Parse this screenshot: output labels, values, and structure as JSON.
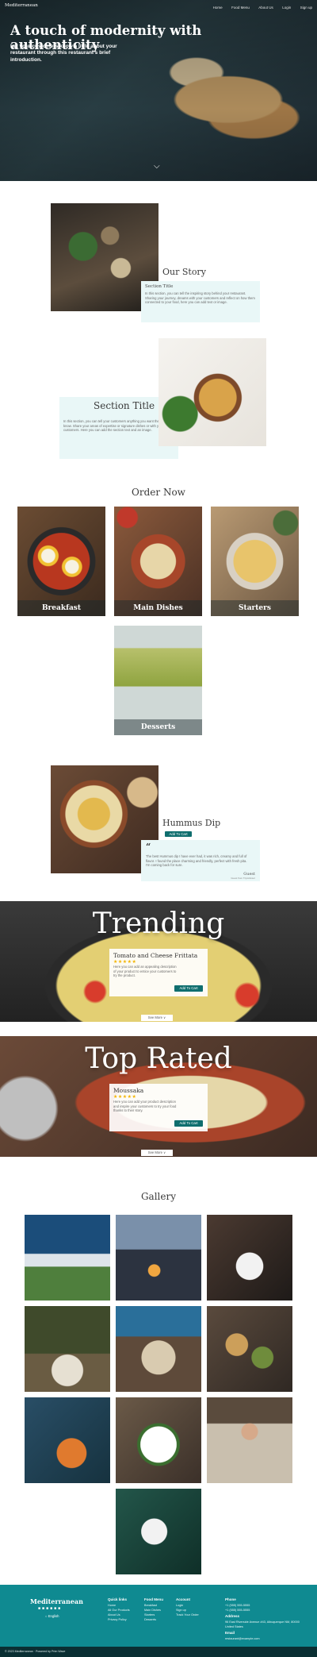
{
  "header": {
    "brand": "Mediterranean",
    "nav": [
      "Home",
      "Food Menu",
      "About Us",
      "Login",
      "Sign up"
    ]
  },
  "hero": {
    "title": "A touch of modernity with authenticity",
    "subtitle": "Let your customers know a little about your restaurant through this restaurant's brief introduction."
  },
  "story": {
    "title": "Our Story",
    "card_title": "Section Title",
    "card_text": "In this section, you can tell the inspiring story behind your restaurant. Sharing your journey, dreams with your customers and reflect on how them connected to your food, here you can add text or image."
  },
  "section2": {
    "title": "Section Title",
    "text": "In this section, you can tell your customers anything you want them to know. Share your areas of expertise or signature dishes or with your customers. Here you can add the section text and an image."
  },
  "order": {
    "title": "Order Now",
    "categories": [
      "Breakfast",
      "Main Dishes",
      "Starters",
      "Desserts"
    ]
  },
  "featured": {
    "title": "Hummus Dip",
    "button": "Add To Cart",
    "quote_mark": "“",
    "quote": "The best Hummus dip I have ever had, it was rich, creamy and full of flavor. I found the place charming and friendly, perfect with fresh pita. I'm coming back for sure.",
    "author": "Guest",
    "author_sub": "Guest from TripAdvisor"
  },
  "trending": {
    "title": "Trending",
    "item": "Tomato and Cheese Frittata",
    "stars": "★★★★★",
    "text": "Here you can add an appealing description of your product to entice your customers to try the product.",
    "button": "Add To Cart",
    "see_more": "See More"
  },
  "toprated": {
    "title": "Top Rated",
    "item": "Moussaka",
    "stars": "★★★★★",
    "text": "Here you can add your product description and inspire your customers to try your food thanks to their story.",
    "button": "Add To Cart",
    "see_more": "See More"
  },
  "gallery": {
    "title": "Gallery"
  },
  "footer": {
    "brand": "Mediterranean",
    "language": "English",
    "quick_links": {
      "title": "Quick links",
      "items": [
        "Home",
        "All Our Products",
        "About Us",
        "Privacy Policy"
      ]
    },
    "food_menu": {
      "title": "Food Menu",
      "items": [
        "Breakfast",
        "Main Dishes",
        "Starters",
        "Desserts"
      ]
    },
    "account": {
      "title": "Account",
      "items": [
        "Login",
        "Sign up",
        "Track Your Order"
      ]
    },
    "phone": {
      "title": "Phone",
      "items": [
        "+1 (555) 555-5555",
        "+1 (555) 555-5555"
      ]
    },
    "address": {
      "title": "Address",
      "value": "96 East Riverside Avenue #43, Albuquerque NM, 80000 United States"
    },
    "email": {
      "title": "Email",
      "value": "restaurant@example.com"
    },
    "copyright": "© 2023 Mediterranean · Powered by Prim Wave"
  }
}
